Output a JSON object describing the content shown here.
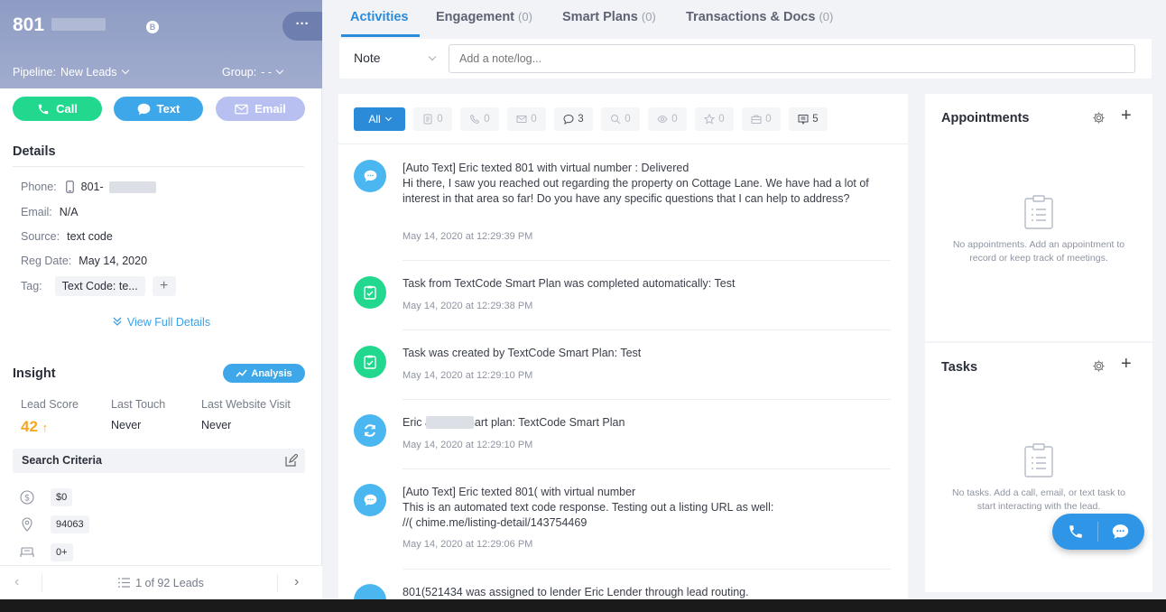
{
  "lead": {
    "name_prefix": "801",
    "pipeline_label": "Pipeline:",
    "pipeline_value": "New Leads",
    "group_label": "Group:",
    "group_value": "- -",
    "badge": "B",
    "more": "···"
  },
  "actions": {
    "call": "Call",
    "text": "Text",
    "email": "Email"
  },
  "details": {
    "title": "Details",
    "phone_label": "Phone:",
    "phone_value": "801-",
    "email_label": "Email:",
    "email_value": "N/A",
    "source_label": "Source:",
    "source_value": "text code",
    "reg_label": "Reg Date:",
    "reg_value": "May 14, 2020",
    "tag_label": "Tag:",
    "tag_value": "Text Code: te...",
    "tag_add": "+",
    "view_full": "View Full Details"
  },
  "insight": {
    "title": "Insight",
    "analysis": "Analysis",
    "lead_score_label": "Lead Score",
    "lead_score_value": "42",
    "arrow": "↑",
    "last_touch_label": "Last Touch",
    "last_touch_value": "Never",
    "last_visit_label": "Last Website Visit",
    "last_visit_value": "Never"
  },
  "search_criteria": {
    "title": "Search Criteria",
    "price": "$0",
    "zip": "94063",
    "beds": "0+"
  },
  "pager": {
    "text": "1 of 92 Leads"
  },
  "tabs": [
    {
      "label": "Activities",
      "count": ""
    },
    {
      "label": "Engagement",
      "count": "(0)"
    },
    {
      "label": "Smart Plans",
      "count": "(0)"
    },
    {
      "label": "Transactions & Docs",
      "count": "(0)"
    }
  ],
  "note": {
    "type": "Note",
    "placeholder": "Add a note/log..."
  },
  "filters": {
    "all": "All",
    "counts": [
      "0",
      "0",
      "0",
      "3",
      "0",
      "0",
      "0",
      "0",
      "5"
    ]
  },
  "activities": [
    {
      "text": "[Auto Text] Eric                    texted 801                    with virtual number : Delivered\nHi there, I saw you reached out regarding the property on Cottage Lane. We have had a lot of interest in that area so far! Do you have any specific questions that I can help to address?",
      "date": "May 14, 2020 at 12:29:39 PM"
    },
    {
      "text": "Task from TextCode Smart Plan was completed automatically: Test",
      "date": "May 14, 2020 at 12:29:38 PM"
    },
    {
      "text": "Task was created by TextCode Smart Plan: Test",
      "date": "May 14, 2020 at 12:29:10 PM"
    },
    {
      "text": "Eric                  added smart plan: TextCode Smart Plan",
      "date": "May 14, 2020 at 12:29:10 PM"
    },
    {
      "text": "[Auto Text] Eric                    texted 801(                    with virtual number\nThis is an automated text code response. Testing out a listing URL as well:\n//(                                chime.me/listing-detail/143754469",
      "date": "May 14, 2020 at 12:29:06 PM"
    },
    {
      "text": "801(521434 was assigned to lender Eric Lender through lead routing.",
      "date": ""
    }
  ],
  "appointments": {
    "title": "Appointments",
    "empty": "No appointments. Add an appointment to record or keep track of meetings."
  },
  "tasks": {
    "title": "Tasks",
    "empty": "No tasks. Add a call, email, or text task to start interacting with the lead."
  }
}
